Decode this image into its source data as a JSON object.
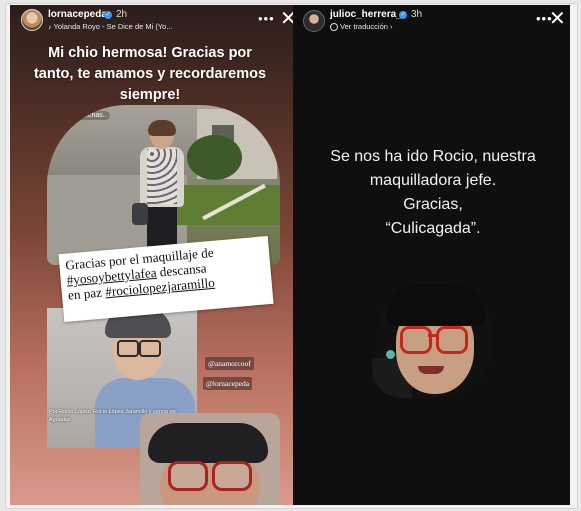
{
  "left_story": {
    "username": "lornacepeda",
    "time": "2h",
    "song": "Yolanda Royo - Se Dice de Mi (Yo...",
    "more_icon": "ellipsis-icon",
    "close_icon": "close-icon",
    "caption": "Mi chio hermosa! Gracias por tanto, te amamos y recordaremos siempre!",
    "photo_tag": "@caraosechas..",
    "sticker_line1": "Gracias por el maquillaje de",
    "sticker_hashtag1": "#yosoybettylafea",
    "sticker_line2": " descansa",
    "sticker_line3": "en paz ",
    "sticker_hashtag2": "#rociolopezjaramillo",
    "mention1": "@anamorcoof",
    "mention2": "@lornacepeda",
    "photo_credit": "Por Rocío López, Rocio López Jaramillo y venga en Aguadas"
  },
  "right_story": {
    "username": "julioc_herrera_",
    "time": "3h",
    "translate": "Ver traducción",
    "more_icon": "ellipsis-icon",
    "close_icon": "close-icon",
    "line1": "Se nos ha ido Rocio, nuestra",
    "line2": "maquilladora jefe.",
    "line3": "Gracias,",
    "line4": "“Culicagada”."
  }
}
